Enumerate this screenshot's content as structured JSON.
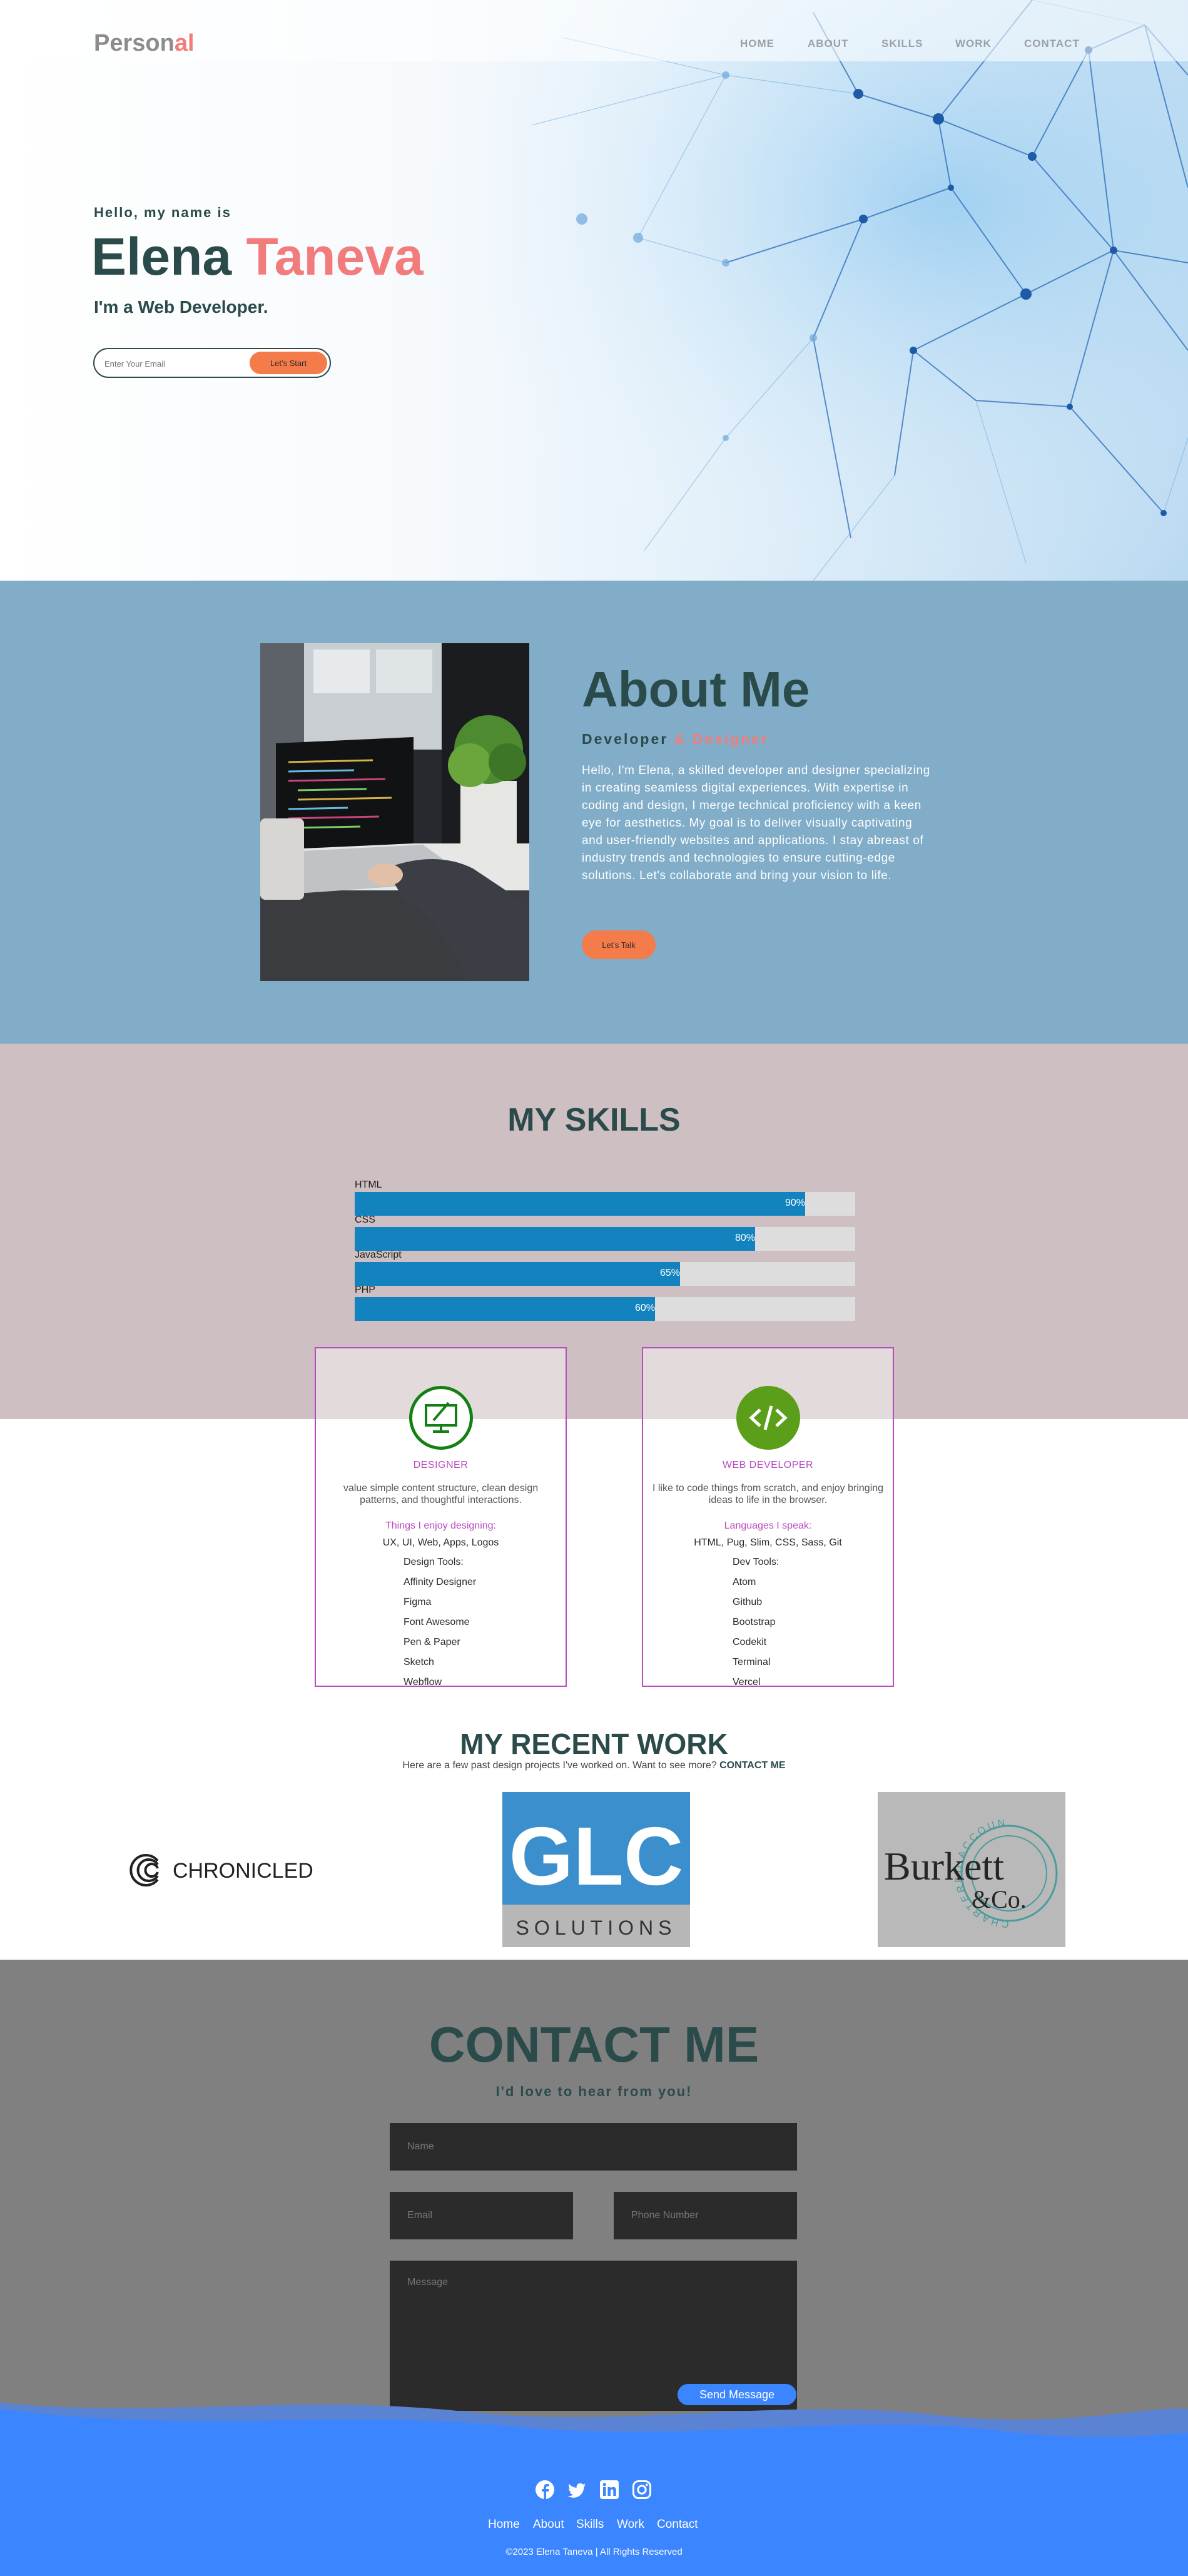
{
  "brand": {
    "part1": "Person",
    "part2": "al"
  },
  "nav": [
    "HOME",
    "ABOUT",
    "SKILLS",
    "WORK",
    "CONTACT"
  ],
  "hero": {
    "greeting": "Hello, my name is",
    "first_name": "Elena",
    "last_name": "Taneva",
    "role": "I'm a Web Developer.",
    "email_placeholder": "Enter Your Email",
    "button": "Let's Start"
  },
  "about": {
    "title": "About Me",
    "subtitle_start": "Developer ",
    "subtitle_end": "& Designer",
    "text": "Hello, I'm Elena, a skilled developer and designer specializing in creating seamless digital experiences. With expertise in coding and design, I merge technical proficiency with a keen eye for aesthetics. My goal is to deliver visually captivating and user-friendly websites and applications. I stay abreast of industry trends and technologies to ensure cutting-edge solutions. Let's collaborate and bring your vision to life.",
    "button": "Let's Talk"
  },
  "skills": {
    "title": "MY SKILLS",
    "bars": [
      {
        "name": "HTML",
        "percent": 90,
        "label": "90%"
      },
      {
        "name": "CSS",
        "percent": 80,
        "label": "80%"
      },
      {
        "name": "JavaScript",
        "percent": 65,
        "label": "65%"
      },
      {
        "name": "PHP",
        "percent": 60,
        "label": "60%"
      }
    ],
    "cards": [
      {
        "title": "DESIGNER",
        "icon": "monitor-pen-icon",
        "accent": "#138013",
        "description": "value simple content structure, clean design patterns, and thoughtful interactions.",
        "subtitle": "Things I enjoy designing:",
        "list_head": "UX, UI, Web, Apps, Logos",
        "tools_title": "Design Tools:",
        "tools": [
          "Affinity Designer",
          "Figma",
          "Font Awesome",
          "Pen & Paper",
          "Sketch",
          "Webflow"
        ]
      },
      {
        "title": "WEB DEVELOPER",
        "icon": "code-icon",
        "accent": "#5a9e1a",
        "description": "I like to code things from scratch, and enjoy bringing ideas to life in the browser.",
        "subtitle": "Languages I speak:",
        "list_head": "HTML, Pug, Slim, CSS, Sass, Git",
        "tools_title": "Dev Tools:",
        "tools": [
          "Atom",
          "Github",
          "Bootstrap",
          "Codekit",
          "Terminal",
          "Vercel"
        ]
      }
    ]
  },
  "work": {
    "title": "MY RECENT WORK",
    "subtitle": "Here are a few past design projects I've worked on. Want to see more? ",
    "contact_link": "CONTACT ME",
    "projects": [
      {
        "name": "CHRONICLED"
      },
      {
        "name": "GLC",
        "tagline": "SOLUTIONS"
      },
      {
        "name": "Burkett",
        "name2": "&Co.",
        "ring_text": "CHARTERED ACCOUNTANTS"
      }
    ]
  },
  "contact": {
    "title": "CONTACT ME",
    "subtitle": "I'd love to hear from you!",
    "name_placeholder": "Name",
    "email_placeholder": "Email",
    "phone_placeholder": "Phone Number",
    "message_placeholder": "Message",
    "send": "Send Message"
  },
  "footer": {
    "social": [
      "facebook-icon",
      "twitter-icon",
      "linkedin-icon",
      "instagram-icon"
    ],
    "links": [
      "Home",
      "About",
      "Skills",
      "Work",
      "Contact"
    ],
    "copyright": "©2023 Elena Taneva | All Rights Reserved"
  },
  "colors": {
    "primary_dark": "#2b4a4a",
    "accent_coral": "#f27c7c",
    "button_orange": "#f47b4a",
    "about_bg": "#81adc8",
    "skills_bg": "#cec0c2",
    "bar_blue": "#1283be",
    "card_border": "#b84bbf",
    "footer_blue": "#3b85ff"
  }
}
